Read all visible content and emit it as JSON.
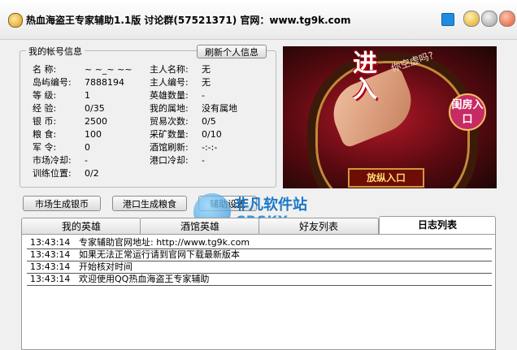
{
  "window": {
    "title": "热血海盗王专家辅助1.1版  讨论群(57521371)  官网：www.tg9k.com"
  },
  "account": {
    "legend": "我的帐号信息",
    "refresh_label": "刷新个人信息",
    "left": [
      {
        "label": "名    称:",
        "value": "~ ~_~ ~~"
      },
      {
        "label": "岛屿编号:",
        "value": "7888194"
      },
      {
        "label": "等    级:",
        "value": "1"
      },
      {
        "label": "经    验:",
        "value": "0/35"
      },
      {
        "label": "银    币:",
        "value": "2500"
      },
      {
        "label": "粮    食:",
        "value": "100"
      },
      {
        "label": "军    令:",
        "value": "0"
      },
      {
        "label": "市场冷却:",
        "value": "-"
      },
      {
        "label": "训练位置:",
        "value": "0/2"
      }
    ],
    "right": [
      {
        "label": "主人名称:",
        "value": "无"
      },
      {
        "label": "主人编号:",
        "value": "无"
      },
      {
        "label": "英雄数量:",
        "value": "-"
      },
      {
        "label": "我的属地:",
        "value": "没有属地"
      },
      {
        "label": "贸易次数:",
        "value": "0/5"
      },
      {
        "label": "采矿数量:",
        "value": "0/10"
      },
      {
        "label": "酒馆刷新:",
        "value": "-:-:-"
      },
      {
        "label": "港口冷却:",
        "value": "-"
      }
    ]
  },
  "ad": {
    "title": "进入",
    "question": "你空虚吗?",
    "side_label": "闺房入口",
    "enter_label": "放纵入口"
  },
  "buttons": {
    "market_silver": "市场生成银币",
    "port_food": "港口生成粮食",
    "helper": "辅助设置"
  },
  "watermark": {
    "name": "非凡软件站",
    "sub": "CRSKY.com"
  },
  "tabs": [
    {
      "label": "我的英雄"
    },
    {
      "label": "酒馆英雄"
    },
    {
      "label": "好友列表"
    },
    {
      "label": "日志列表"
    }
  ],
  "log": [
    {
      "time": "13:43:14",
      "message": "专家辅助官网地址: http://www.tg9k.com"
    },
    {
      "time": "13:43:14",
      "message": "如果无法正常运行请到官网下载最新版本"
    },
    {
      "time": "13:43:14",
      "message": "开始核对时间"
    },
    {
      "time": "13:43:14",
      "message": "欢迎使用QQ热血海盗王专家辅助"
    }
  ]
}
